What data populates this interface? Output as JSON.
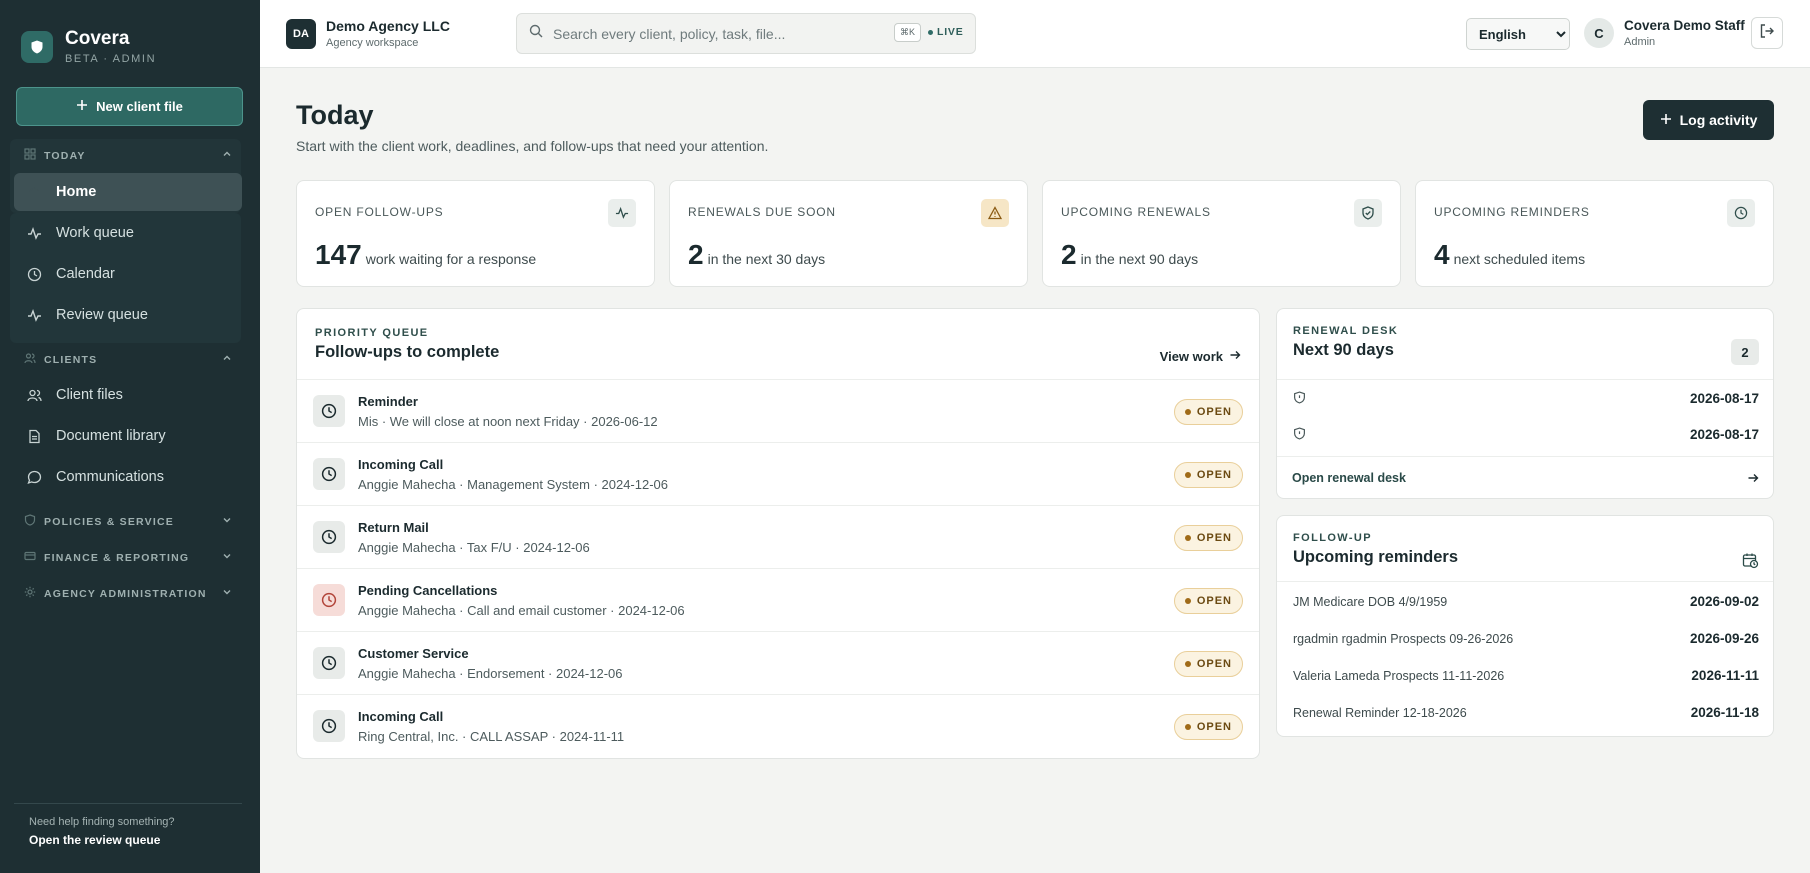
{
  "sidebar": {
    "brand": {
      "name": "Covera",
      "sub": "BETA · ADMIN"
    },
    "new_client_label": "New client file",
    "sections": {
      "today": "TODAY",
      "clients": "CLIENTS",
      "policies": "POLICIES & SERVICE",
      "finance": "FINANCE & REPORTING",
      "admin": "AGENCY ADMINISTRATION"
    },
    "today_items": [
      {
        "label": "Home",
        "icon": "home-icon"
      },
      {
        "label": "Work queue",
        "icon": "activity-icon"
      },
      {
        "label": "Calendar",
        "icon": "clock-icon"
      },
      {
        "label": "Review queue",
        "icon": "activity-icon"
      }
    ],
    "client_items": [
      {
        "label": "Client files",
        "icon": "users-icon"
      },
      {
        "label": "Document library",
        "icon": "document-icon"
      },
      {
        "label": "Communications",
        "icon": "chat-icon"
      }
    ],
    "footer": {
      "help_text": "Need help finding something?",
      "help_link": "Open the review queue"
    }
  },
  "header": {
    "agency_badge": "DA",
    "agency_name": "Demo Agency LLC",
    "agency_sub": "Agency workspace",
    "search_placeholder": "Search every client, policy, task, file...",
    "search_shortcut": "⌘K",
    "live_label": "LIVE",
    "language": "English",
    "user_initial": "C",
    "user_name": "Covera Demo Staff",
    "user_role": "Admin"
  },
  "main": {
    "title": "Today",
    "subtitle": "Start with the client work, deadlines, and follow-ups that need your attention.",
    "log_activity_label": "Log activity",
    "stats": [
      {
        "label": "OPEN FOLLOW-UPS",
        "value": "147",
        "text": "work waiting for a response",
        "icon": "activity-icon"
      },
      {
        "label": "RENEWALS DUE SOON",
        "value": "2",
        "text": "in the next 30 days",
        "icon": "warning-icon"
      },
      {
        "label": "UPCOMING RENEWALS",
        "value": "2",
        "text": "in the next 90 days",
        "icon": "shield-check-icon"
      },
      {
        "label": "UPCOMING REMINDERS",
        "value": "4",
        "text": "next scheduled items",
        "icon": "clock-icon"
      }
    ],
    "priority_queue": {
      "eyebrow": "PRIORITY QUEUE",
      "title": "Follow-ups to complete",
      "view_work_label": "View work",
      "status_label": "OPEN",
      "rows": [
        {
          "title": "Reminder",
          "meta": "Mis · We will close at noon next Friday · 2026-06-12"
        },
        {
          "title": "Incoming Call",
          "meta": "Anggie Mahecha · Management System · 2024-12-06"
        },
        {
          "title": "Return Mail",
          "meta": "Anggie Mahecha · Tax F/U · 2024-12-06"
        },
        {
          "title": "Pending Cancellations",
          "meta": "Anggie Mahecha · Call and email customer · 2024-12-06"
        },
        {
          "title": "Customer Service",
          "meta": "Anggie Mahecha · Endorsement · 2024-12-06"
        },
        {
          "title": "Incoming Call",
          "meta": "Ring Central, Inc. · CALL ASSAP · 2024-11-11"
        }
      ]
    },
    "renewal_desk": {
      "eyebrow": "RENEWAL DESK",
      "title": "Next 90 days",
      "count": "2",
      "rows": [
        {
          "date": "2026-08-17"
        },
        {
          "date": "2026-08-17"
        }
      ],
      "link_label": "Open renewal desk"
    },
    "reminders": {
      "eyebrow": "FOLLOW-UP",
      "title": "Upcoming reminders",
      "rows": [
        {
          "name": "JM Medicare DOB 4/9/1959",
          "date": "2026-09-02"
        },
        {
          "name": "rgadmin rgadmin Prospects 09-26-2026",
          "date": "2026-09-26"
        },
        {
          "name": "Valeria Lameda Prospects 11-11-2026",
          "date": "2026-11-11"
        },
        {
          "name": "Renewal Reminder 12-18-2026",
          "date": "2026-11-18"
        }
      ]
    }
  },
  "colors": {
    "sidebar": "#1e2f33",
    "accent": "#2e6963",
    "badge_bg": "#fbf3e1",
    "warning_bg": "#f6e6c6",
    "danger_bg": "#f6dcd8"
  }
}
